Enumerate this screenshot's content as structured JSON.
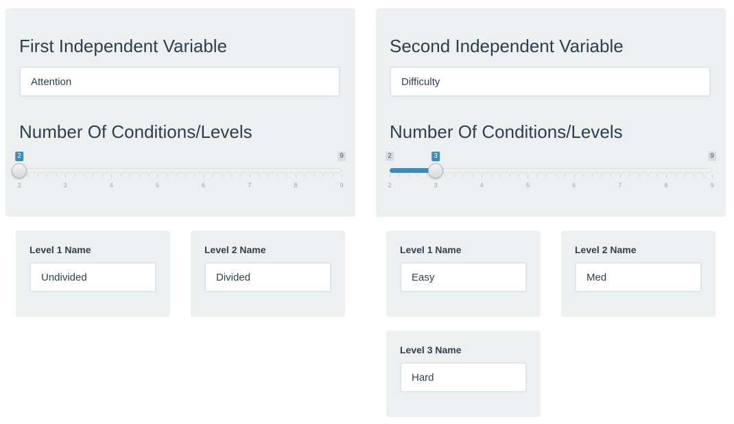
{
  "iv1": {
    "heading": "First Independent Variable",
    "input_value": "Attention",
    "levels_heading": "Number Of Conditions/Levels",
    "slider": {
      "min": 2,
      "max": 9,
      "value": 2,
      "min_label": "2",
      "max_label": "9",
      "value_label": "2",
      "ticks": [
        "2",
        "3",
        "4",
        "5",
        "6",
        "7",
        "8",
        "9"
      ]
    },
    "levels": [
      {
        "label": "Level 1 Name",
        "value": "Undivided"
      },
      {
        "label": "Level 2 Name",
        "value": "Divided"
      }
    ]
  },
  "iv2": {
    "heading": "Second Independent Variable",
    "input_value": "Difficulty",
    "levels_heading": "Number Of Conditions/Levels",
    "slider": {
      "min": 2,
      "max": 9,
      "value": 3,
      "min_label": "2",
      "max_label": "9",
      "value_label": "3",
      "ticks": [
        "2",
        "3",
        "4",
        "5",
        "6",
        "7",
        "8",
        "9"
      ]
    },
    "levels": [
      {
        "label": "Level 1 Name",
        "value": "Easy"
      },
      {
        "label": "Level 2 Name",
        "value": "Med"
      },
      {
        "label": "Level 3 Name",
        "value": "Hard"
      }
    ]
  },
  "colors": {
    "panel_bg": "#ecf0f1",
    "slider_fill": "#3c8dbc",
    "text": "#2c3e50"
  }
}
